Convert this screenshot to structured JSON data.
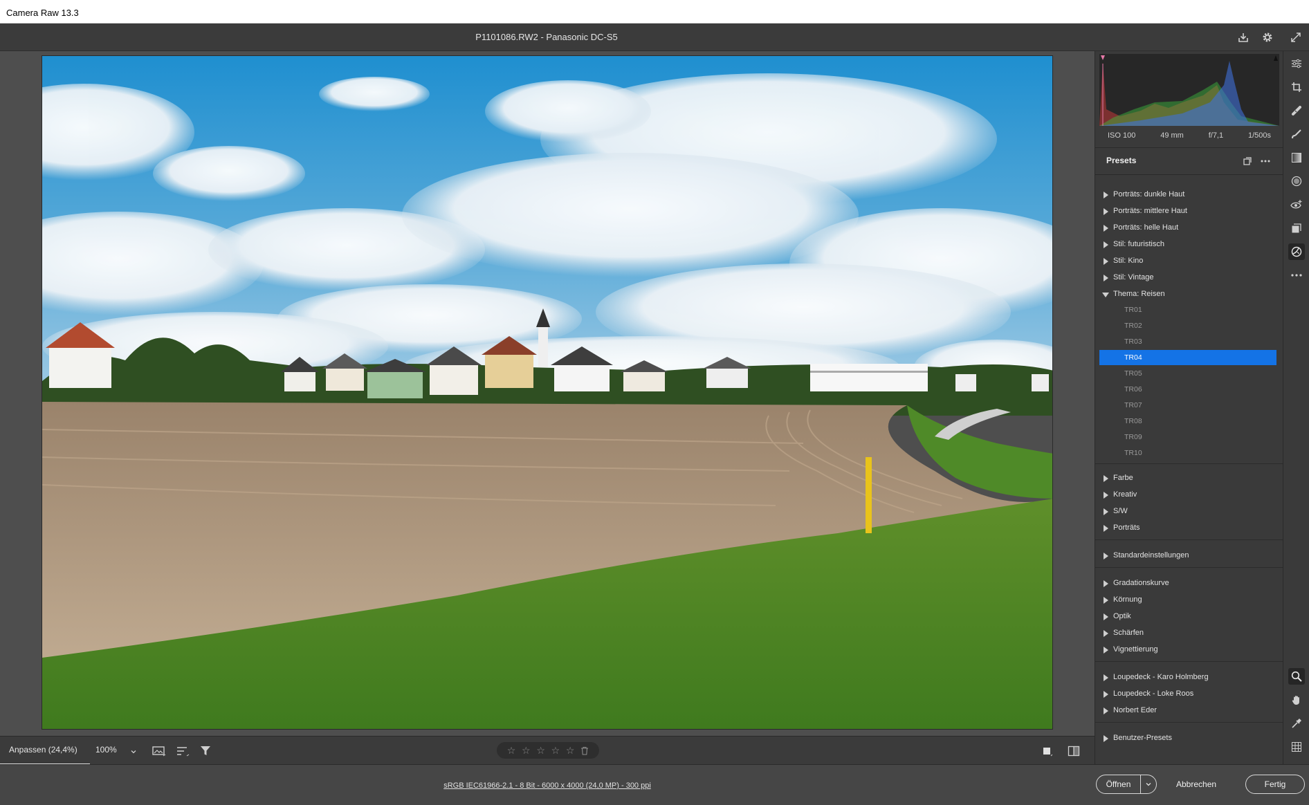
{
  "window": {
    "title": "Camera Raw 13.3"
  },
  "header": {
    "file_title": "P1101086.RW2  -  Panasonic DC-S5"
  },
  "exif": {
    "iso": "ISO 100",
    "focal": "49 mm",
    "aperture": "f/7,1",
    "shutter": "1/500s"
  },
  "presets": {
    "title": "Presets",
    "groups": [
      {
        "label": "Porträts: dunkle Haut",
        "open": false
      },
      {
        "label": "Porträts: mittlere Haut",
        "open": false
      },
      {
        "label": "Porträts: helle Haut",
        "open": false
      },
      {
        "label": "Stil: futuristisch",
        "open": false
      },
      {
        "label": "Stil: Kino",
        "open": false
      },
      {
        "label": "Stil: Vintage",
        "open": false
      },
      {
        "label": "Thema: Reisen",
        "open": true
      }
    ],
    "items": [
      "TR01",
      "TR02",
      "TR03",
      "TR04",
      "TR05",
      "TR06",
      "TR07",
      "TR08",
      "TR09",
      "TR10"
    ],
    "selected_item": "TR04",
    "groups2": [
      "Farbe",
      "Kreativ",
      "S/W",
      "Porträts"
    ],
    "groups3": [
      "Standardeinstellungen"
    ],
    "groups4": [
      "Gradationskurve",
      "Körnung",
      "Optik",
      "Schärfen",
      "Vignettierung"
    ],
    "groups5": [
      "Loupedeck - Karo Holmberg",
      "Loupedeck - Loke Roos",
      "Norbert Eder"
    ],
    "groups6": [
      "Benutzer-Presets"
    ]
  },
  "bottom": {
    "zoom_fit": "Anpassen (24,4%)",
    "zoom_value": "100%",
    "rating_stars": 5
  },
  "status": {
    "file_info": "sRGB IEC61966-2.1 - 8 Bit - 6000 x 4000 (24,0 MP) - 300 ppi",
    "open_label": "Öffnen",
    "cancel_label": "Abbrechen",
    "done_label": "Fertig"
  },
  "colors": {
    "accent": "#1473e6",
    "panel": "#3a3a3a",
    "canvas": "#4e4e4e"
  }
}
